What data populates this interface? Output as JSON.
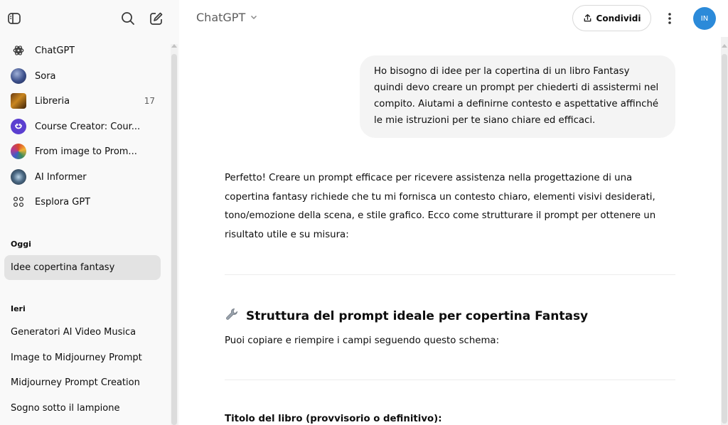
{
  "sidebar": {
    "gpts": [
      {
        "label": "ChatGPT",
        "icon": "openai-logo-icon"
      },
      {
        "label": "Sora",
        "icon": "sora-avatar-icon"
      },
      {
        "label": "Libreria",
        "icon": "library-thumbnail-icon",
        "count": "17"
      },
      {
        "label": "Course Creator: Cour...",
        "icon": "course-creator-avatar-icon"
      },
      {
        "label": "From image to Prom...",
        "icon": "image-to-prompt-avatar-icon"
      },
      {
        "label": "AI Informer",
        "icon": "ai-informer-avatar-icon"
      },
      {
        "label": "Esplora GPT",
        "icon": "explore-grid-icon"
      }
    ],
    "today_label": "Oggi",
    "today_items": [
      "Idee copertina fantasy"
    ],
    "yesterday_label": "Ieri",
    "yesterday_items": [
      "Generatori AI Video Musica",
      "Image to Midjourney Prompt",
      "Midjourney Prompt Creation",
      "Sogno sotto il lampione"
    ]
  },
  "header": {
    "model": "ChatGPT",
    "share_label": "Condividi",
    "avatar_initials": "IN",
    "avatar_color": "#2b8ad9"
  },
  "conversation": {
    "user_message": "Ho bisogno di idee per la copertina di un libro Fantasy quindi devo creare un prompt per chiederti di assistermi nel compito. Aiutami a definirne contesto e aspettative affinché le mie istruzioni per te siano chiare ed efficaci.",
    "assistant_intro": "Perfetto! Creare un prompt efficace per ricevere assistenza nella progettazione di una copertina fantasy richiede che tu mi fornisca un contesto chiaro, elementi visivi desiderati, tono/emozione della scena, e stile grafico. Ecco come strutturare il prompt per ottenere un risultato utile e su misura:",
    "section_heading": "Struttura del prompt ideale per copertina Fantasy",
    "section_intro": "Puoi copiare e riempire i campi seguendo questo schema:",
    "field_title": "Titolo del libro (provvisorio o definitivo):"
  }
}
